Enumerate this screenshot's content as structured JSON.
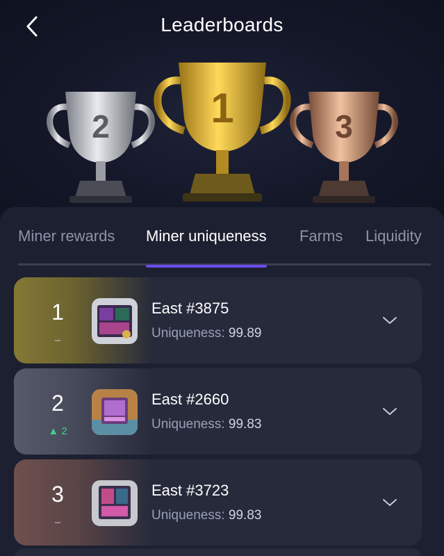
{
  "header": {
    "title": "Leaderboards",
    "back_icon": "chevron-left-icon"
  },
  "trophies": [
    {
      "place": "2",
      "color": "#b9bcc4"
    },
    {
      "place": "1",
      "color": "#e0b53a"
    },
    {
      "place": "3",
      "color": "#c88f6e"
    }
  ],
  "tabs": [
    {
      "label": "Miner rewards",
      "active": false
    },
    {
      "label": "Miner uniqueness",
      "active": true
    },
    {
      "label": "Farms",
      "active": false
    },
    {
      "label": "Liquidity",
      "active": false
    }
  ],
  "colors": {
    "accent": "#6c4cf0",
    "rank_up": "#3fd08a",
    "gold": "#8a7d3a",
    "silver": "#5e6172",
    "bronze": "#7a5550"
  },
  "rows": [
    {
      "rank": "1",
      "change": "–",
      "change_dir": "none",
      "name": "East #3875",
      "uniq_label": "Uniqueness:",
      "uniq_value": "99.89"
    },
    {
      "rank": "2",
      "change": "▲ 2",
      "change_dir": "up",
      "name": "East #2660",
      "uniq_label": "Uniqueness:",
      "uniq_value": "99.83"
    },
    {
      "rank": "3",
      "change": "–",
      "change_dir": "none",
      "name": "East #3723",
      "uniq_label": "Uniqueness:",
      "uniq_value": "99.83"
    }
  ]
}
